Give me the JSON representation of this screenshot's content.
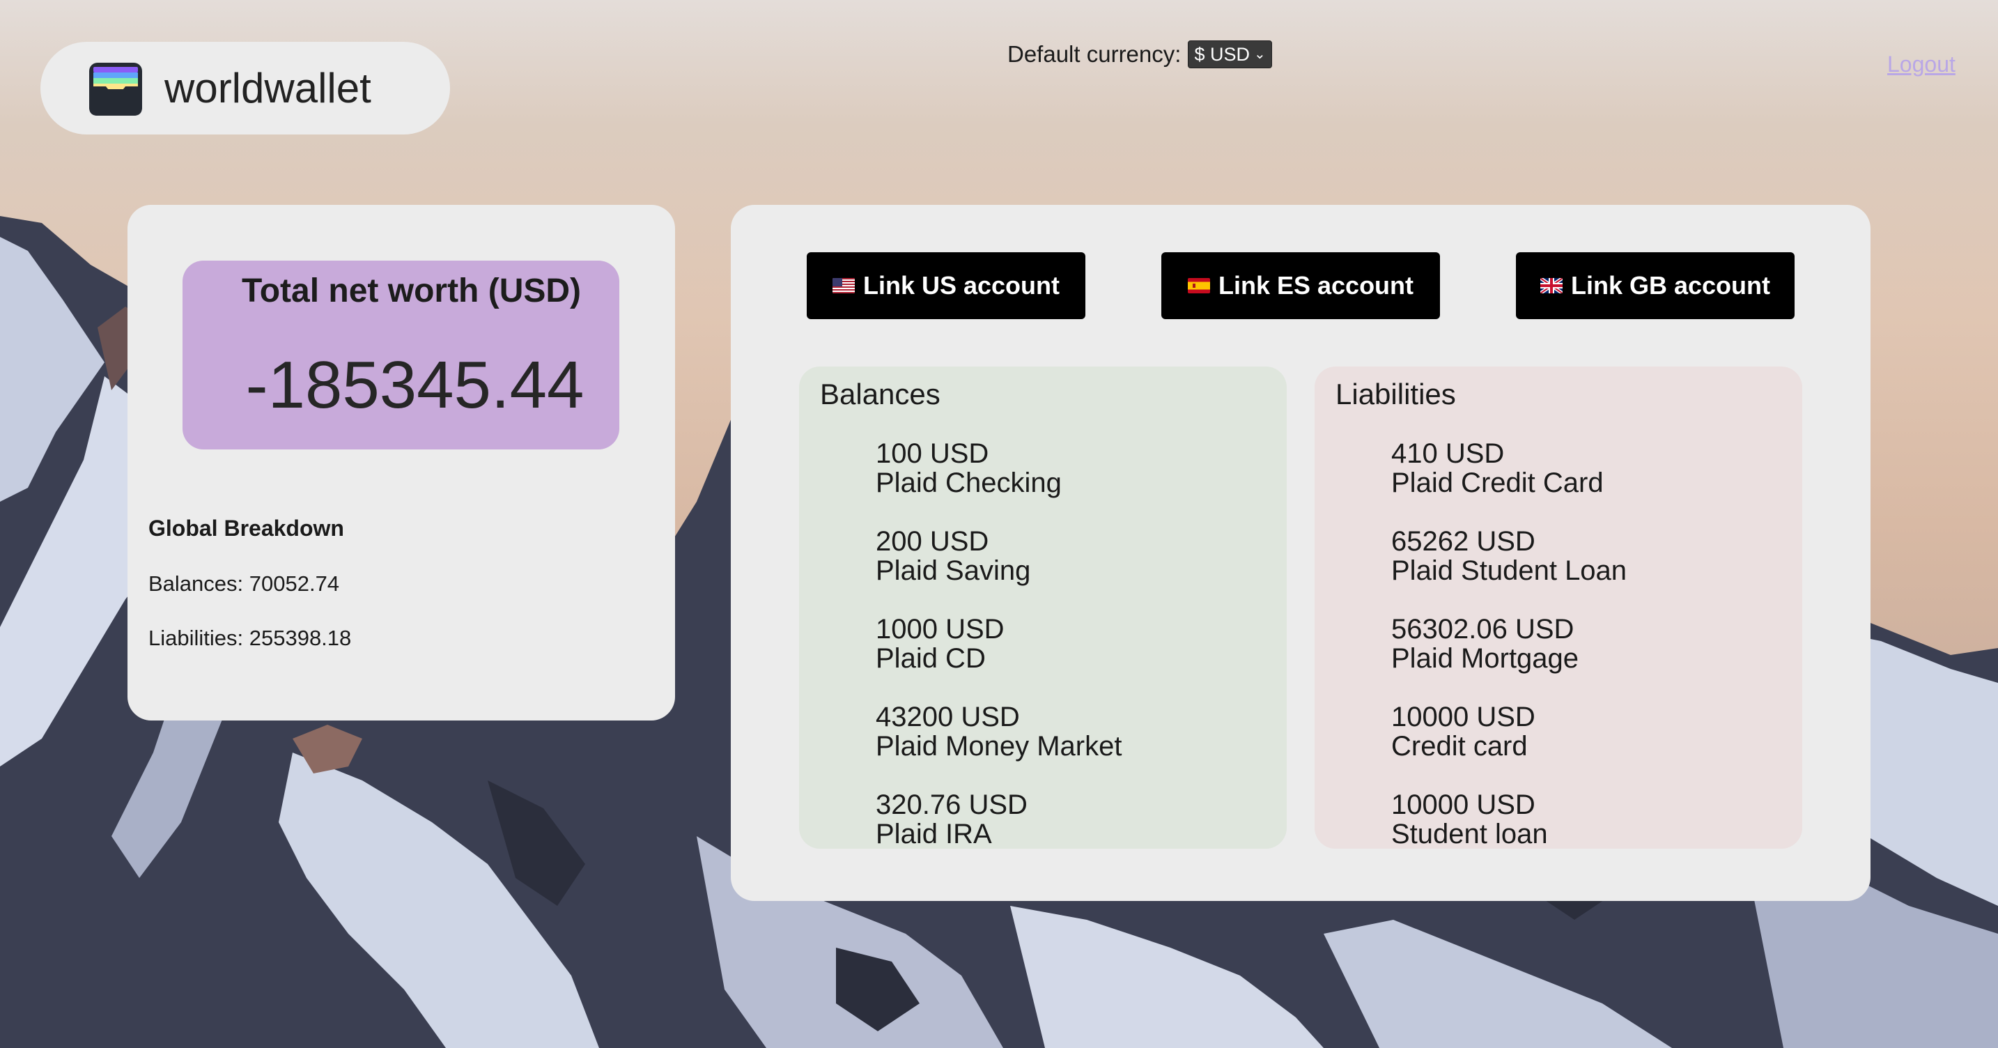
{
  "app": {
    "name": "worldwallet"
  },
  "header": {
    "currency_label": "Default currency:",
    "currency_selected": "$ USD",
    "logout_label": "Logout"
  },
  "summary": {
    "title": "Total net worth (USD)",
    "value": "-185345.44",
    "breakdown_title": "Global Breakdown",
    "balances_line": "Balances: 70052.74",
    "liabilities_line": "Liabilities: 255398.18"
  },
  "link_buttons": [
    {
      "label": "Link US account",
      "flag": "us-flag-icon"
    },
    {
      "label": "Link ES account",
      "flag": "es-flag-icon"
    },
    {
      "label": "Link GB account",
      "flag": "gb-flag-icon"
    }
  ],
  "balances": {
    "title": "Balances",
    "items": [
      {
        "amount": "100 USD",
        "name": "Plaid Checking"
      },
      {
        "amount": "200 USD",
        "name": "Plaid Saving"
      },
      {
        "amount": "1000 USD",
        "name": "Plaid CD"
      },
      {
        "amount": "43200 USD",
        "name": "Plaid Money Market"
      },
      {
        "amount": "320.76 USD",
        "name": "Plaid IRA"
      }
    ]
  },
  "liabilities": {
    "title": "Liabilities",
    "items": [
      {
        "amount": "410 USD",
        "name": "Plaid Credit Card"
      },
      {
        "amount": "65262 USD",
        "name": "Plaid Student Loan"
      },
      {
        "amount": "56302.06 USD",
        "name": "Plaid Mortgage"
      },
      {
        "amount": "10000 USD",
        "name": "Credit card"
      },
      {
        "amount": "10000 USD",
        "name": "Student loan"
      }
    ]
  },
  "colors": {
    "networth_bg": "#c8aada",
    "balances_bg": "#dfe6dd",
    "liabilities_bg": "#ebe0e0",
    "button_bg": "#000000",
    "logout": "#b9a7e6"
  }
}
